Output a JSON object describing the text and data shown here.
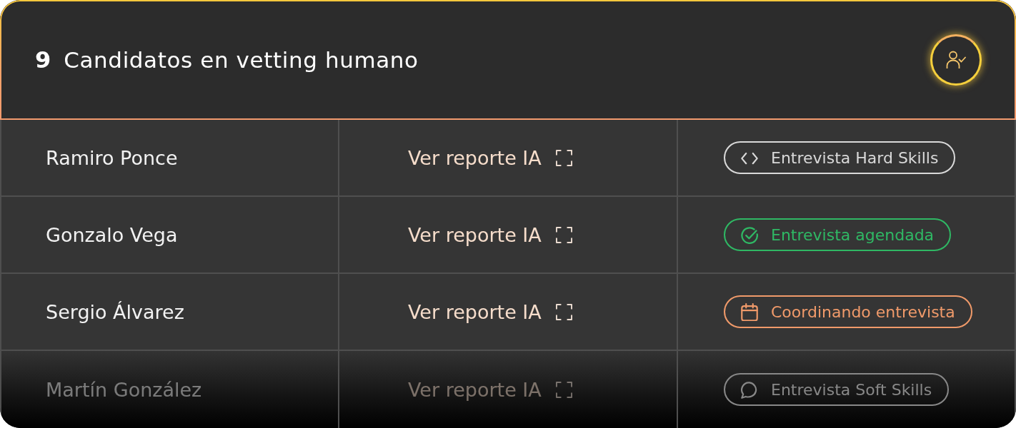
{
  "header": {
    "count": "9",
    "title": "Candidatos en vetting humano"
  },
  "rows": [
    {
      "name": "Ramiro Ponce",
      "report_link": "Ver reporte IA",
      "status": {
        "kind": "code",
        "label": "Entrevista Hard Skills",
        "color": "#d9d9d9"
      }
    },
    {
      "name": "Gonzalo Vega",
      "report_link": "Ver reporte IA",
      "status": {
        "kind": "check",
        "label": "Entrevista agendada",
        "color": "#2fb864"
      }
    },
    {
      "name": "Sergio Álvarez",
      "report_link": "Ver reporte IA",
      "status": {
        "kind": "calendar",
        "label": "Coordinando entrevista",
        "color": "#f09a6a"
      }
    },
    {
      "name": "Martín González",
      "report_link": "Ver reporte IA",
      "status": {
        "kind": "chat",
        "label": "Entrevista Soft Skills",
        "color": "#888888"
      }
    }
  ]
}
